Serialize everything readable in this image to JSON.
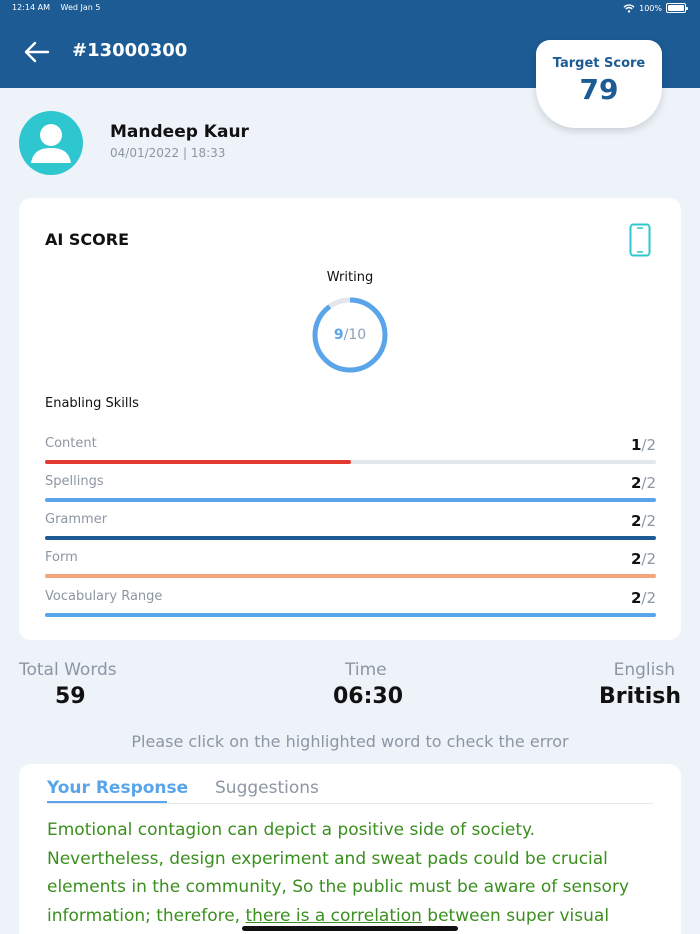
{
  "status_bar": {
    "time": "12:14 AM",
    "date": "Wed Jan 5",
    "battery": "100%"
  },
  "header": {
    "title": "#13000300"
  },
  "target": {
    "label": "Target Score",
    "value": "79"
  },
  "user": {
    "name": "Mandeep Kaur",
    "date": "04/01/2022 | 18:33"
  },
  "score_card": {
    "title": "AI SCORE",
    "section": "Writing",
    "score": "9",
    "max": "/10",
    "score_fraction": 0.9,
    "skills_title": "Enabling Skills",
    "skills": [
      {
        "label": "Content",
        "score": "1",
        "max": "/2",
        "fraction": 0.5,
        "color": "#e23a2e"
      },
      {
        "label": "Spellings",
        "score": "2",
        "max": "/2",
        "fraction": 1.0,
        "color": "#5aa5ea"
      },
      {
        "label": "Grammer",
        "score": "2",
        "max": "/2",
        "fraction": 1.0,
        "color": "#1d5b94"
      },
      {
        "label": "Form",
        "score": "2",
        "max": "/2",
        "fraction": 1.0,
        "color": "#f5a57a"
      },
      {
        "label": "Vocabulary Range",
        "score": "2",
        "max": "/2",
        "fraction": 1.0,
        "color": "#5aa5ea"
      }
    ]
  },
  "stats": {
    "total_words_label": "Total Words",
    "total_words": "59",
    "time_label": "Time",
    "time": "06:30",
    "english_label": "English",
    "english": "British"
  },
  "hint": "Please click on the highlighted word to check the error",
  "response": {
    "tab_active": "Your Response",
    "tab_inactive": "Suggestions",
    "text_before": "Emotional contagion can depict a positive side of society. Nevertheless, design experiment and sweat pads could be crucial elements in the community, So the public must be aware of sensory information; therefore, ",
    "highlight": "there is a correlation",
    "text_after": " between super visual"
  },
  "colors": {
    "header": "#1d5b94",
    "accent": "#5aa5ea",
    "avatar": "#2ec7cf",
    "response_text": "#3a8f1e"
  }
}
